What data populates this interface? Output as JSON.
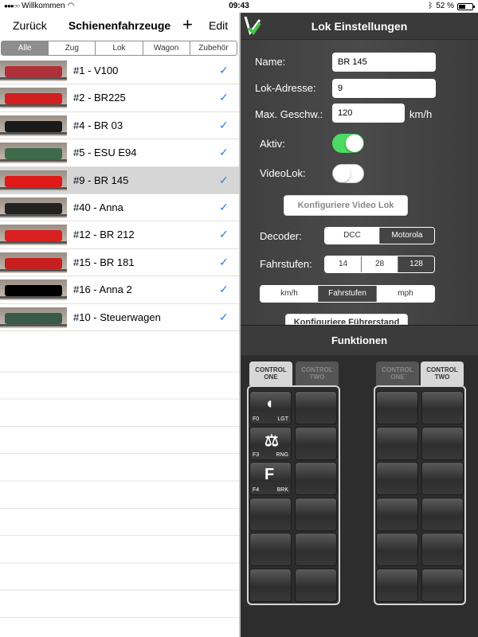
{
  "status": {
    "carrier": "Willkommen",
    "time": "09:43",
    "battery": "52 %",
    "battery_level": 0.52
  },
  "left": {
    "back_label": "Zurück",
    "title": "Schienenfahrzeuge",
    "add_label": "+",
    "edit_label": "Edit",
    "filters": [
      "Alle",
      "Zug",
      "Lok",
      "Wagon",
      "Zubehör"
    ],
    "selected_filter": "Alle",
    "items": [
      {
        "label": "#1 - V100",
        "color": "#b0303a",
        "selected": false
      },
      {
        "label": "#2 - BR225",
        "color": "#d02020",
        "selected": false
      },
      {
        "label": "#4 - BR 03",
        "color": "#1a1a1a",
        "selected": false
      },
      {
        "label": "#5 - ESU E94",
        "color": "#3e6b4a",
        "selected": false
      },
      {
        "label": "#9 - BR 145",
        "color": "#e01818",
        "selected": true
      },
      {
        "label": "#40 - Anna",
        "color": "#222222",
        "selected": false
      },
      {
        "label": "#12 - BR 212",
        "color": "#d82020",
        "selected": false
      },
      {
        "label": "#15 - BR 181",
        "color": "#c82020",
        "selected": false
      },
      {
        "label": "#16 - Anna 2",
        "color": "#000000",
        "selected": false
      },
      {
        "label": "#10 - Steuerwagen",
        "color": "#3a5a48",
        "selected": false
      }
    ]
  },
  "lok": {
    "title": "Lok Einstellungen",
    "name_label": "Name:",
    "name_value": "BR 145",
    "address_label": "Lok-Adresse:",
    "address_value": "9",
    "speed_label": "Max. Geschw.:",
    "speed_value": "120",
    "speed_unit": "km/h",
    "active_label": "Aktiv:",
    "active_on": true,
    "videolok_label": "VideoLok:",
    "videolok_on": false,
    "config_video_label": "Konfiguriere Video Lok",
    "decoder_label": "Decoder:",
    "decoder_options": [
      "DCC",
      "Motorola"
    ],
    "decoder_selected": "Motorola",
    "steps_label": "Fahrstufen:",
    "steps_options": [
      "14",
      "28",
      "128"
    ],
    "steps_selected": "128",
    "unit_options": [
      "km/h",
      "Fahrstufen",
      "mph"
    ],
    "unit_selected": "Fahrstufen",
    "config_cab_label": "Konfiguriere Führerstand"
  },
  "functions": {
    "title": "Funktionen",
    "left_tabs": [
      "CONTROL ONE",
      "CONTROL TWO"
    ],
    "right_tabs": [
      "CONTROL ONE",
      "CONTROL TWO"
    ],
    "buttons": [
      {
        "num": "F0",
        "name": "LGT",
        "icon": "light-icon",
        "glyph": "◖"
      },
      {
        "num": "F3",
        "name": "RNG",
        "icon": "bell-icon",
        "glyph": "⚖"
      },
      {
        "num": "F4",
        "name": "BRK",
        "icon": "brake-icon",
        "glyph": "F"
      }
    ]
  }
}
